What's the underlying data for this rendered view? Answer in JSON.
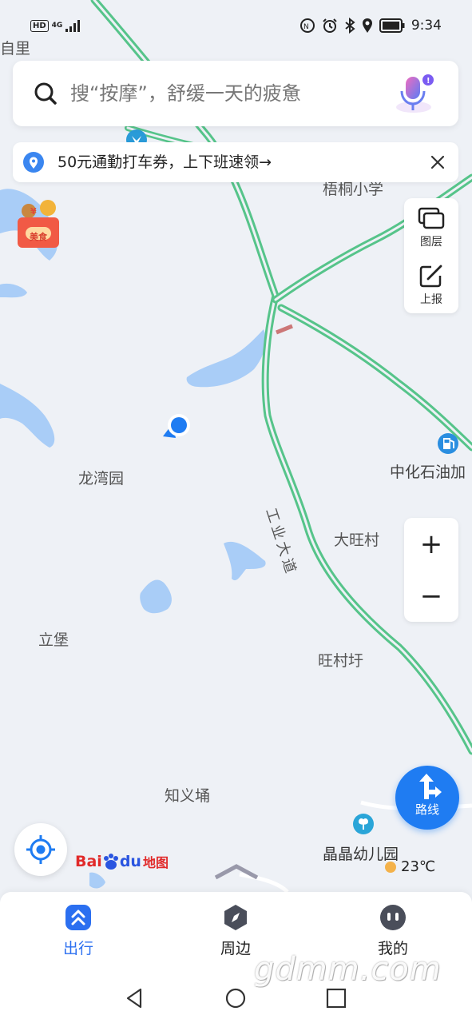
{
  "status_bar": {
    "network_badge": "HD",
    "network_type": "4G",
    "time": "9:34"
  },
  "search": {
    "placeholder": "搜“按摩”，舒缓一天的疲惫"
  },
  "banner": {
    "text": "50元通勤打车券，上下班速领→"
  },
  "food_badge": {
    "label": "美食"
  },
  "tools": {
    "layers_label": "图层",
    "report_label": "上报"
  },
  "zoom": {
    "in_label": "+",
    "out_label": "−"
  },
  "route_button": {
    "label": "路线"
  },
  "map_labels": {
    "top_left_partial": "自里",
    "school": "梧桐小学",
    "longwan": "龙湾园",
    "gas_station": "中化石油加",
    "road": "工业大道",
    "dawang": "大旺村",
    "libao": "立堡",
    "wangcunxu": "旺村圩",
    "zhiyiyong": "知义埇",
    "kindergarten": "晶晶幼儿园"
  },
  "logo": {
    "text_bai": "Bai",
    "text_du": "du",
    "text_map": "地图"
  },
  "weather": {
    "temperature": "23℃"
  },
  "bottom_nav": {
    "items": [
      {
        "label": "出行",
        "icon": "travel-icon",
        "active": true
      },
      {
        "label": "周边",
        "icon": "compass-icon",
        "active": false
      },
      {
        "label": "我的",
        "icon": "profile-icon",
        "active": false
      }
    ]
  },
  "watermark": "gdmm.com",
  "colors": {
    "accent": "#2b6ff0",
    "map_bg": "#eef1f6",
    "water": "#a9cdf7",
    "road_green": "#56c48a"
  }
}
